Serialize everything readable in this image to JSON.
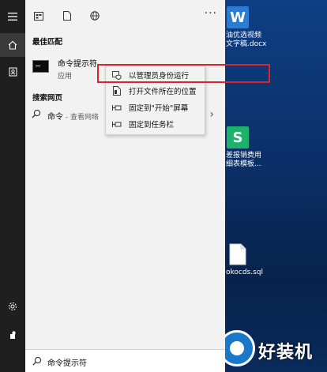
{
  "start_menu": {
    "top_bar": {
      "icons": [
        "apps-icon",
        "document-icon",
        "web-icon"
      ],
      "more_label": "···"
    },
    "best_match": {
      "section_label": "最佳匹配",
      "title": "命令提示符",
      "subtitle": "应用"
    },
    "web": {
      "section_label": "搜索网页",
      "query": "命令",
      "hint": " - 查看网络"
    },
    "search_box": {
      "value": "命令提示符"
    },
    "rail": {
      "icons": [
        "hamburger-menu-icon",
        "home-icon",
        "contacts-icon",
        "settings-icon",
        "user-icon"
      ],
      "active": "home-icon"
    }
  },
  "context_menu": {
    "items": [
      {
        "label": "以管理员身份运行",
        "icon": "run-as-admin-icon"
      },
      {
        "label": "打开文件所在的位置",
        "icon": "open-file-location-icon"
      },
      {
        "label": "固定到\"开始\"屏幕",
        "icon": "pin-icon"
      },
      {
        "label": "固定到任务栏",
        "icon": "pin-icon"
      }
    ]
  },
  "desktop": {
    "icons": [
      {
        "label_lines": [
          "油优选视频",
          "文字稿.docx"
        ],
        "icon": "word-document-icon",
        "color": "#2b7cd3",
        "letter": "W"
      },
      {
        "label_lines": [
          "差报销费用",
          "细表模板..."
        ],
        "icon": "spreadsheet-icon",
        "color": "#1bb36a",
        "letter": "S"
      },
      {
        "label_lines": [
          "okocds.sql"
        ],
        "icon": "file-icon"
      }
    ],
    "watermark": "好装机"
  },
  "colors": {
    "highlight_border": "#d8262c",
    "rail_bg": "#1f1f1f",
    "panel_bg": "#f2f2f2"
  }
}
